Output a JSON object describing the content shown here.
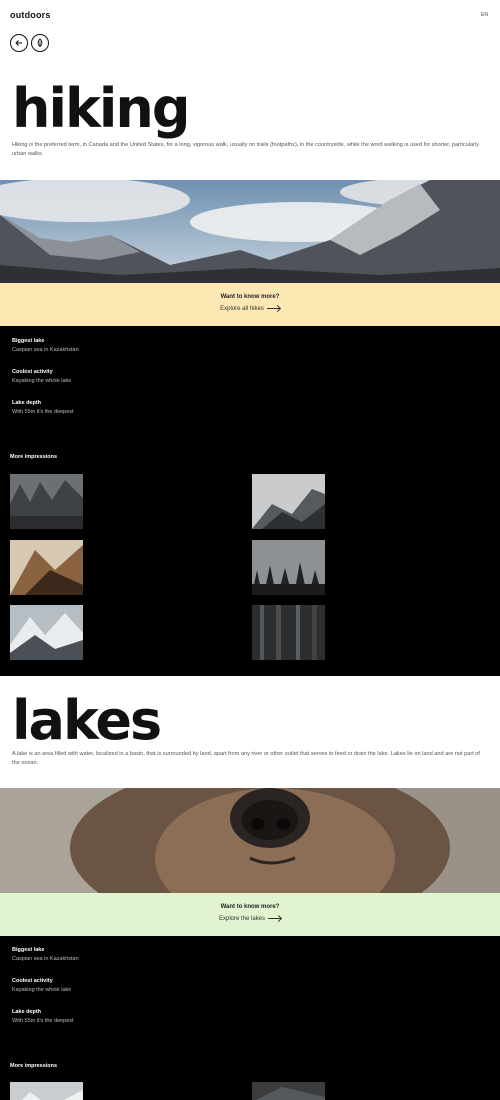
{
  "header": {
    "logo": "outdoors",
    "lang": "EN",
    "back_icon": "arrow-left-icon",
    "leaf_icon": "leaf-icon"
  },
  "sections": [
    {
      "title": "hiking",
      "description": "Hiking is the preferred term, in Canada and the United States, for a long, vigorous walk, usually on trails (footpaths), in the countryside, while the word walking is used for shorter, particularly urban walks.",
      "cta": {
        "question": "Want to know more?",
        "link": "Explore all hikes",
        "color": "#fde7b3"
      },
      "facts": [
        {
          "title": "Biggest lake",
          "value": "Caspian sea in Kazakhstan"
        },
        {
          "title": "Coolest activity",
          "value": "Kayaking the whole lake"
        },
        {
          "title": "Lake depth",
          "value": "With 55m it's the deepest"
        }
      ],
      "more_label": "More impressions"
    },
    {
      "title": "lakes",
      "description": "A lake is an area filled with water, localized in a basin, that is surrounded by land, apart from any river or other outlet that serves to feed or drain the lake. Lakes lie on land and are not part of the ocean.",
      "cta": {
        "question": "Want to know more?",
        "link": "Explore the lakes",
        "color": "#e2f3cf"
      },
      "facts": [
        {
          "title": "Biggest lake",
          "value": "Caspian sea in Kazakhstan"
        },
        {
          "title": "Coolest activity",
          "value": "Kayaking the whole lake"
        },
        {
          "title": "Lake depth",
          "value": "With 55m it's the deepest"
        }
      ],
      "more_label": "More impressions"
    }
  ]
}
